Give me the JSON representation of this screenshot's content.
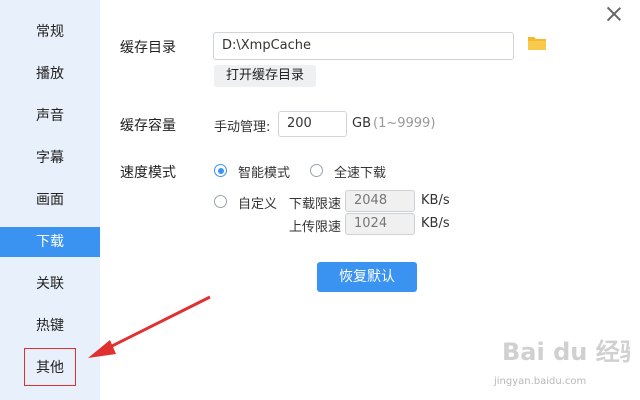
{
  "sidebar": {
    "items": [
      {
        "label": "常规"
      },
      {
        "label": "播放"
      },
      {
        "label": "声音"
      },
      {
        "label": "字幕"
      },
      {
        "label": "画面"
      },
      {
        "label": "下载"
      },
      {
        "label": "关联"
      },
      {
        "label": "热键"
      },
      {
        "label": "其他"
      }
    ],
    "active": "下载"
  },
  "cache_dir": {
    "label": "缓存目录",
    "path": "D:\\XmpCache",
    "open_button": "打开缓存目录"
  },
  "cache_capacity": {
    "label": "缓存容量",
    "manual_label": "手动管理:",
    "value": "200",
    "unit": "GB",
    "range_hint": "(1~9999)"
  },
  "speed_mode": {
    "label": "速度模式",
    "options": [
      {
        "label": "智能模式",
        "checked": true
      },
      {
        "label": "全速下载",
        "checked": false
      },
      {
        "label": "自定义",
        "checked": false
      }
    ],
    "download_limit_label": "下载限速",
    "download_limit_value": "2048",
    "upload_limit_label": "上传限速",
    "upload_limit_value": "1024",
    "unit": "KB/s"
  },
  "restore_button": "恢复默认",
  "watermark": {
    "logo_text": "Bai du 经验",
    "url": "jingyan.baidu.com"
  },
  "colors": {
    "accent": "#3a93f0",
    "sidebar_bg": "#e8f0fb",
    "annotation_red": "#e03030"
  }
}
